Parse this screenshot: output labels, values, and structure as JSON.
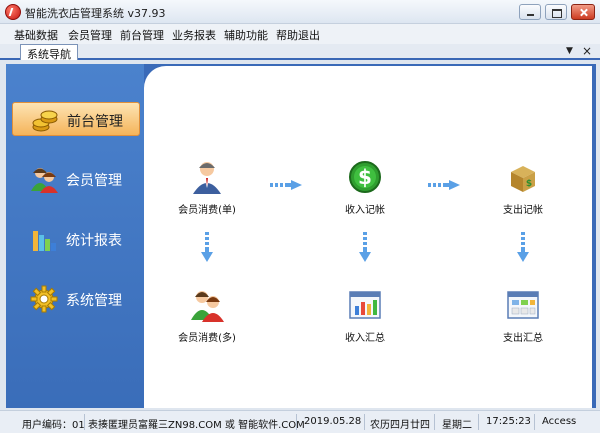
{
  "window": {
    "title": "智能洗衣店管理系统 v37.93"
  },
  "menu": {
    "items": [
      "基础数据",
      "会员管理",
      "前台管理",
      "业务报表",
      "辅助功能",
      "帮助退出"
    ]
  },
  "tabs": {
    "active": "系统导航",
    "dropdown_glyph": "▼",
    "close_glyph": "×"
  },
  "sidebar": {
    "items": [
      {
        "label": "前台管理",
        "icon": "coins-icon",
        "active": true
      },
      {
        "label": "会员管理",
        "icon": "members-icon",
        "active": false
      },
      {
        "label": "统计报表",
        "icon": "bar-chart-icon",
        "active": false
      },
      {
        "label": "系统管理",
        "icon": "gear-icon",
        "active": false
      }
    ]
  },
  "nodes": {
    "member_consume_single": "会员消费(单)",
    "income_record": "收入记帐",
    "expense_record": "支出记帐",
    "member_consume_multi": "会员消费(多)",
    "income_summary": "收入汇总",
    "expense_summary": "支出汇总"
  },
  "status": {
    "user_code": "用户编码：01",
    "support": "表揍匿理员富羅三ZN98.COM 或 智能软件.COM",
    "date": "2019.05.28",
    "lunar_date": "农历四月廿四",
    "weekday": "星期二",
    "time": "17:25:23",
    "database": "Access"
  },
  "colors": {
    "sidebar_blue": "#3a6db9",
    "active_orange": "#f5b45a",
    "arrow_blue": "#5aa0e6"
  }
}
